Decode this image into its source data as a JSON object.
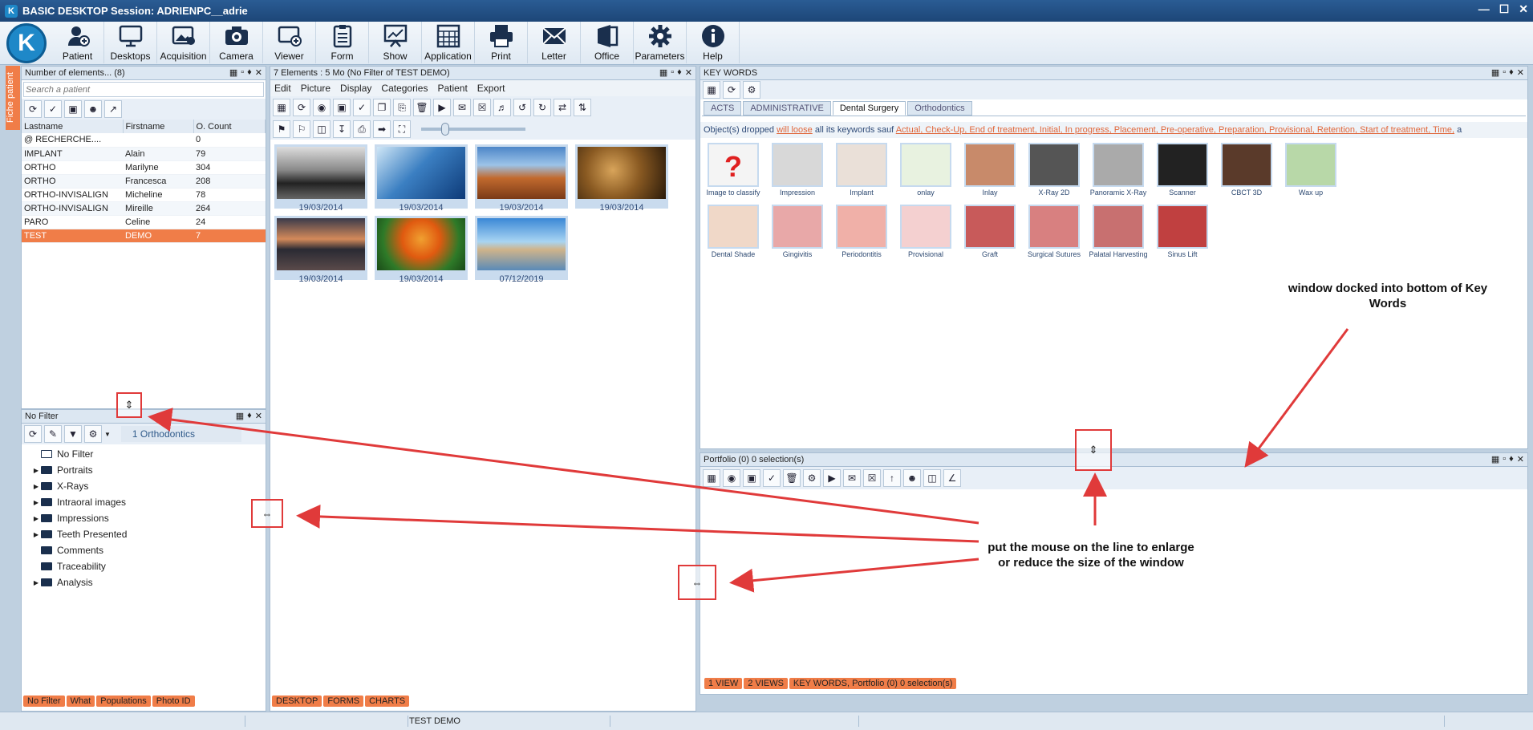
{
  "window": {
    "title": "BASIC DESKTOP Session: ADRIENPC__adrie",
    "logo_letter": "K"
  },
  "ribbon": {
    "buttons": [
      {
        "label": "Patient",
        "icon": "add-patient-icon"
      },
      {
        "label": "Desktops",
        "icon": "desktops-icon"
      },
      {
        "label": "Acquisition",
        "icon": "acquisition-icon"
      },
      {
        "label": "Camera",
        "icon": "camera-icon"
      },
      {
        "label": "Viewer",
        "icon": "viewer-icon"
      },
      {
        "label": "Form",
        "icon": "form-icon"
      },
      {
        "label": "Show",
        "icon": "show-icon"
      },
      {
        "label": "Application",
        "icon": "application-icon"
      },
      {
        "label": "Print",
        "icon": "print-icon"
      },
      {
        "label": "Letter",
        "icon": "letter-icon"
      },
      {
        "label": "Office",
        "icon": "office-icon"
      },
      {
        "label": "Parameters",
        "icon": "gear-icon"
      },
      {
        "label": "Help",
        "icon": "help-icon"
      }
    ]
  },
  "side_tab": "Fiche patient",
  "patients": {
    "header": "Number of elements... (8)",
    "search_placeholder": "Search a patient",
    "columns": [
      "Lastname",
      "Firstname",
      "O. Count"
    ],
    "rows": [
      [
        "@ RECHERCHE....",
        "",
        "0"
      ],
      [
        "IMPLANT",
        "Alain",
        "79"
      ],
      [
        "ORTHO",
        "Marilyne",
        "304"
      ],
      [
        "ORTHO",
        "Francesca",
        "208"
      ],
      [
        "ORTHO-INVISALIGN",
        "Micheline",
        "78"
      ],
      [
        "ORTHO-INVISALIGN",
        "Mireille",
        "264"
      ],
      [
        "PARO",
        "Celine",
        "24"
      ],
      [
        "TEST",
        "DEMO",
        "7"
      ]
    ],
    "selected_index": 7
  },
  "filter": {
    "header": "No Filter",
    "current": "1 Orthodontics",
    "tree": [
      {
        "label": "No Filter",
        "expandable": false,
        "open": true
      },
      {
        "label": "Portraits",
        "expandable": true
      },
      {
        "label": "X-Rays",
        "expandable": true
      },
      {
        "label": "Intraoral images",
        "expandable": true
      },
      {
        "label": "Impressions",
        "expandable": true
      },
      {
        "label": "Teeth Presented",
        "expandable": true
      },
      {
        "label": "Comments",
        "expandable": false
      },
      {
        "label": "Traceability",
        "expandable": false
      },
      {
        "label": "Analysis",
        "expandable": true
      }
    ],
    "bottom_tabs": [
      "No Filter",
      "What",
      "Populations",
      "Photo ID"
    ]
  },
  "gallery": {
    "header": "7 Elements : 5 Mo (No Filter of TEST DEMO)",
    "menu": [
      "Edit",
      "Picture",
      "Display",
      "Categories",
      "Patient",
      "Export"
    ],
    "images": [
      {
        "date": "19/03/2014",
        "subject": "city-bridge"
      },
      {
        "date": "19/03/2014",
        "subject": "surfer"
      },
      {
        "date": "19/03/2014",
        "subject": "desert"
      },
      {
        "date": "19/03/2014",
        "subject": "cheetah"
      },
      {
        "date": "19/03/2014",
        "subject": "lake-sunset"
      },
      {
        "date": "19/03/2014",
        "subject": "butterfly"
      },
      {
        "date": "07/12/2019",
        "subject": "beach-rocks"
      }
    ],
    "bottom_tabs": [
      "DESKTOP",
      "FORMS",
      "CHARTS"
    ]
  },
  "keywords": {
    "header": "KEY WORDS",
    "tabs": [
      "ACTS",
      "ADMINISTRATIVE",
      "Dental Surgery",
      "Orthodontics"
    ],
    "active_tab": 2,
    "drop_text_a": "Object(s) dropped",
    "drop_text_b": "will loose",
    "drop_text_c": "all its keywords  sauf",
    "drop_text_d": "Actual, Check-Up, End of treatment, Initial, In progress, Placement, Pre-operative, Preparation, Provisional, Retention, Start of treatment, Time,",
    "drop_text_e": "a",
    "items": [
      "Image to classify",
      "Impression",
      "Implant",
      "onlay",
      "Inlay",
      "X-Ray 2D",
      "Panoramic X-Ray",
      "Scanner",
      "CBCT 3D",
      "Wax up",
      "Dental Shade",
      "Gingivitis",
      "Periodontitis",
      "Provisional",
      "Graft",
      "Surgical Sutures",
      "Palatal Harvesting",
      "Sinus Lift"
    ]
  },
  "portfolio": {
    "header": "Portfolio (0) 0 selection(s)",
    "bottom_tabs": [
      "1 VIEW",
      "2 VIEWS",
      "KEY WORDS, Portfolio (0) 0 selection(s)"
    ]
  },
  "annotations": {
    "note1": "window docked into bottom of Key Words",
    "note2": "put the mouse on the line to enlarge or reduce the size of the window"
  },
  "status": {
    "patient": "TEST DEMO"
  },
  "colors": {
    "accent": "#f07d48",
    "title": "#1d4677",
    "annotation": "#e03a3a"
  }
}
